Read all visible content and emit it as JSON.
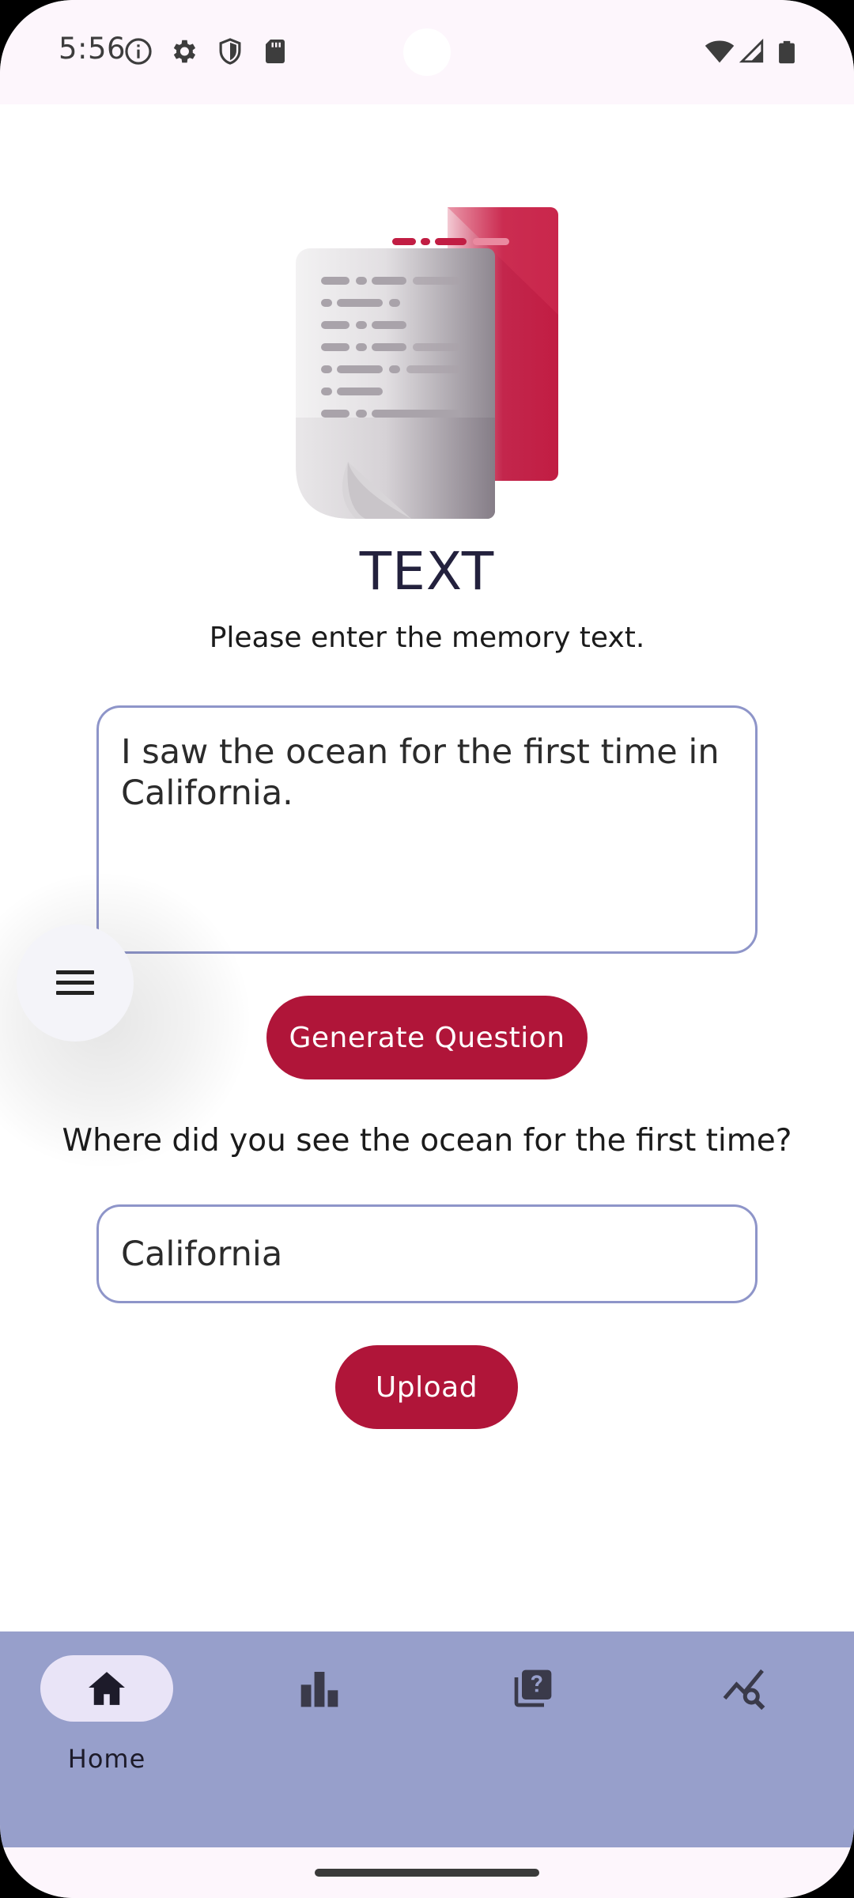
{
  "status_bar": {
    "time": "5:56",
    "left_icons": [
      "info-icon",
      "settings-icon",
      "shield-icon",
      "sd-card-icon"
    ],
    "right_icons": [
      "wifi-icon",
      "signal-icon",
      "battery-icon"
    ]
  },
  "hero": {
    "icon": "document-icon"
  },
  "page": {
    "title": "TEXT",
    "subtitle": "Please enter the memory text."
  },
  "memory_input": {
    "value": "I saw the ocean for the first time in California."
  },
  "buttons": {
    "generate": "Generate Question",
    "upload": "Upload"
  },
  "question": {
    "text": "Where did you see the ocean for the first time?"
  },
  "answer_input": {
    "value": "California"
  },
  "fab": {
    "icon": "menu-icon"
  },
  "bottom_nav": {
    "items": [
      {
        "label": "Home",
        "icon": "home-icon",
        "selected": true
      },
      {
        "label": "",
        "icon": "bar-chart-icon",
        "selected": false
      },
      {
        "label": "",
        "icon": "quiz-icon",
        "selected": false
      },
      {
        "label": "",
        "icon": "query-stats-icon",
        "selected": false
      }
    ]
  },
  "colors": {
    "accent": "#b01539",
    "nav_background": "#979fcb",
    "input_border": "#8e95c9",
    "nav_pill": "#e9e4f7",
    "title": "#23213d"
  }
}
